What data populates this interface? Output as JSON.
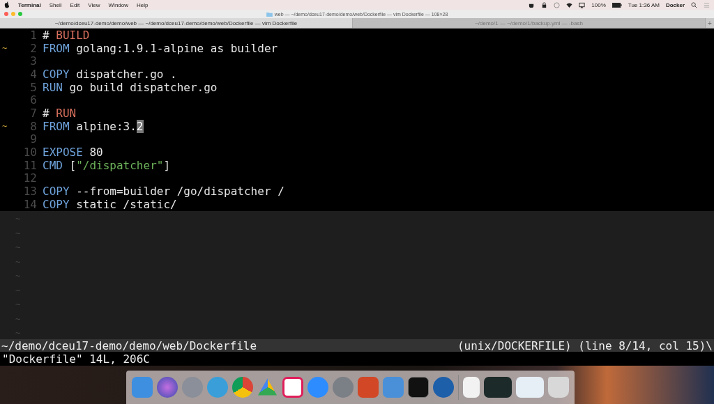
{
  "menu_bar": {
    "app": "Terminal",
    "items": [
      "Shell",
      "Edit",
      "View",
      "Window",
      "Help"
    ],
    "battery": "100%",
    "clock": "Tue 1:36 AM",
    "user": "Docker"
  },
  "window": {
    "title": "web — ~/demo/dceu17-demo/demo/web/Dockerfile — vim Dockerfile — 108×28"
  },
  "tabs": [
    {
      "label": "~/demo/dceu17-demo/demo/web — ~/demo/dceu17-demo/demo/web/Dockerfile — vim Dockerfile",
      "selected": true
    },
    {
      "label": "~/demo/1 — ~/demo/1/backup.yml — -bash",
      "selected": false
    }
  ],
  "new_tab": "+",
  "editor": {
    "lines": [
      {
        "number": "1",
        "tokens": [
          {
            "kind": "plain",
            "text": "# "
          },
          {
            "kind": "comment",
            "text": "BUILD"
          }
        ]
      },
      {
        "number": "2",
        "sign": "~",
        "tokens": [
          {
            "kind": "keyword",
            "text": "FROM"
          },
          {
            "kind": "plain",
            "text": " golang:1.9.1-alpine as builder"
          }
        ]
      },
      {
        "number": "3"
      },
      {
        "number": "4",
        "tokens": [
          {
            "kind": "keyword",
            "text": "COPY"
          },
          {
            "kind": "plain",
            "text": " dispatcher.go ."
          }
        ]
      },
      {
        "number": "5",
        "tokens": [
          {
            "kind": "keyword",
            "text": "RUN"
          },
          {
            "kind": "plain",
            "text": " go build dispatcher.go"
          }
        ]
      },
      {
        "number": "6"
      },
      {
        "number": "7",
        "tokens": [
          {
            "kind": "plain",
            "text": "# "
          },
          {
            "kind": "comment",
            "text": "RUN"
          }
        ]
      },
      {
        "number": "8",
        "sign": "~",
        "tokens": [
          {
            "kind": "keyword",
            "text": "FROM"
          },
          {
            "kind": "plain",
            "text": " alpine:3."
          },
          {
            "kind": "cursor",
            "text": "2"
          }
        ]
      },
      {
        "number": "9"
      },
      {
        "number": "10",
        "tokens": [
          {
            "kind": "keyword",
            "text": "EXPOSE"
          },
          {
            "kind": "plain",
            "text": " 80"
          }
        ]
      },
      {
        "number": "11",
        "tokens": [
          {
            "kind": "keyword",
            "text": "CMD"
          },
          {
            "kind": "plain",
            "text": " ["
          },
          {
            "kind": "string",
            "text": "\"/dispatcher\""
          },
          {
            "kind": "plain",
            "text": "]"
          }
        ]
      },
      {
        "number": "12"
      },
      {
        "number": "13",
        "tokens": [
          {
            "kind": "keyword",
            "text": "COPY"
          },
          {
            "kind": "plain",
            "text": " --from=builder /go/dispatcher /"
          }
        ]
      },
      {
        "number": "14",
        "tokens": [
          {
            "kind": "keyword",
            "text": "COPY"
          },
          {
            "kind": "plain",
            "text": " static /static/"
          }
        ]
      }
    ],
    "filler": [
      "~",
      "~",
      "~",
      "~",
      "~",
      "~",
      "~",
      "~",
      "~"
    ]
  },
  "status_line": {
    "path": "~/demo/dceu17-demo/demo/web/Dockerfile",
    "info": "(unix/DOCKERFILE) (line 8/14, col 15)\\"
  },
  "message_line": "\"Dockerfile\" 14L, 206C"
}
